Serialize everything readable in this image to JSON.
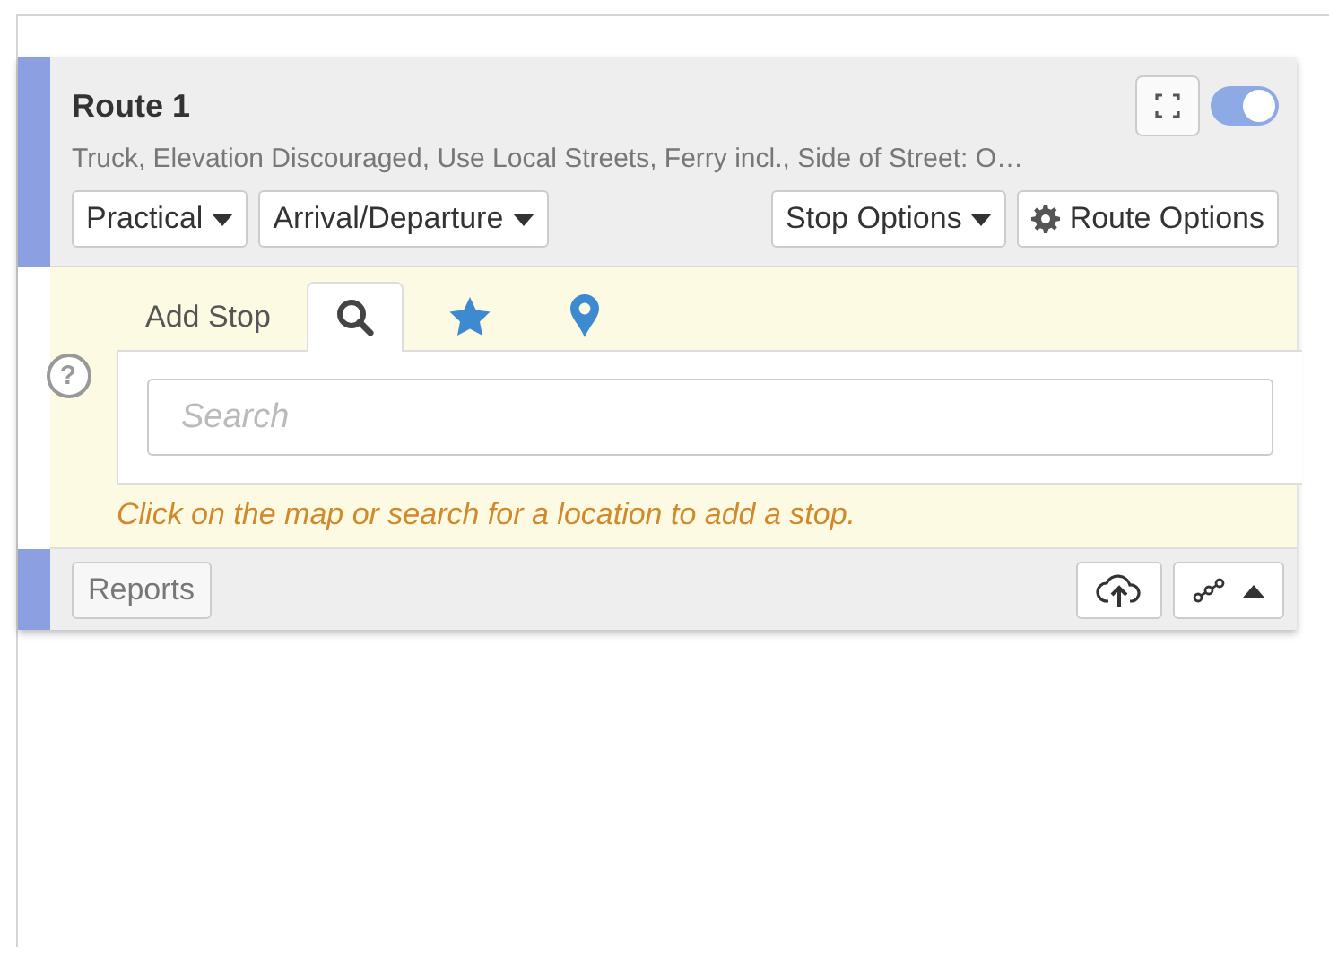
{
  "route": {
    "title": "Route 1",
    "visible": true,
    "summary": "Truck, Elevation Discouraged, Use Local Streets, Ferry incl., Side of Street: O…",
    "left_buttons": [
      {
        "label": "Practical",
        "kind": "dropdown"
      },
      {
        "label": "Arrival/Departure",
        "kind": "dropdown"
      }
    ],
    "right_buttons": [
      {
        "label": "Stop Options",
        "kind": "dropdown"
      },
      {
        "label": "Route Options",
        "kind": "gear"
      }
    ]
  },
  "add_stop": {
    "help": "?",
    "label": "Add Stop",
    "tabs": [
      {
        "kind": "search",
        "selected": true
      },
      {
        "kind": "star",
        "selected": false
      },
      {
        "kind": "pin",
        "selected": false
      }
    ],
    "search": {
      "placeholder": "Search"
    },
    "hint": "Click on the map or search for a location to add a stop."
  },
  "footer": {
    "reports": "Reports"
  }
}
